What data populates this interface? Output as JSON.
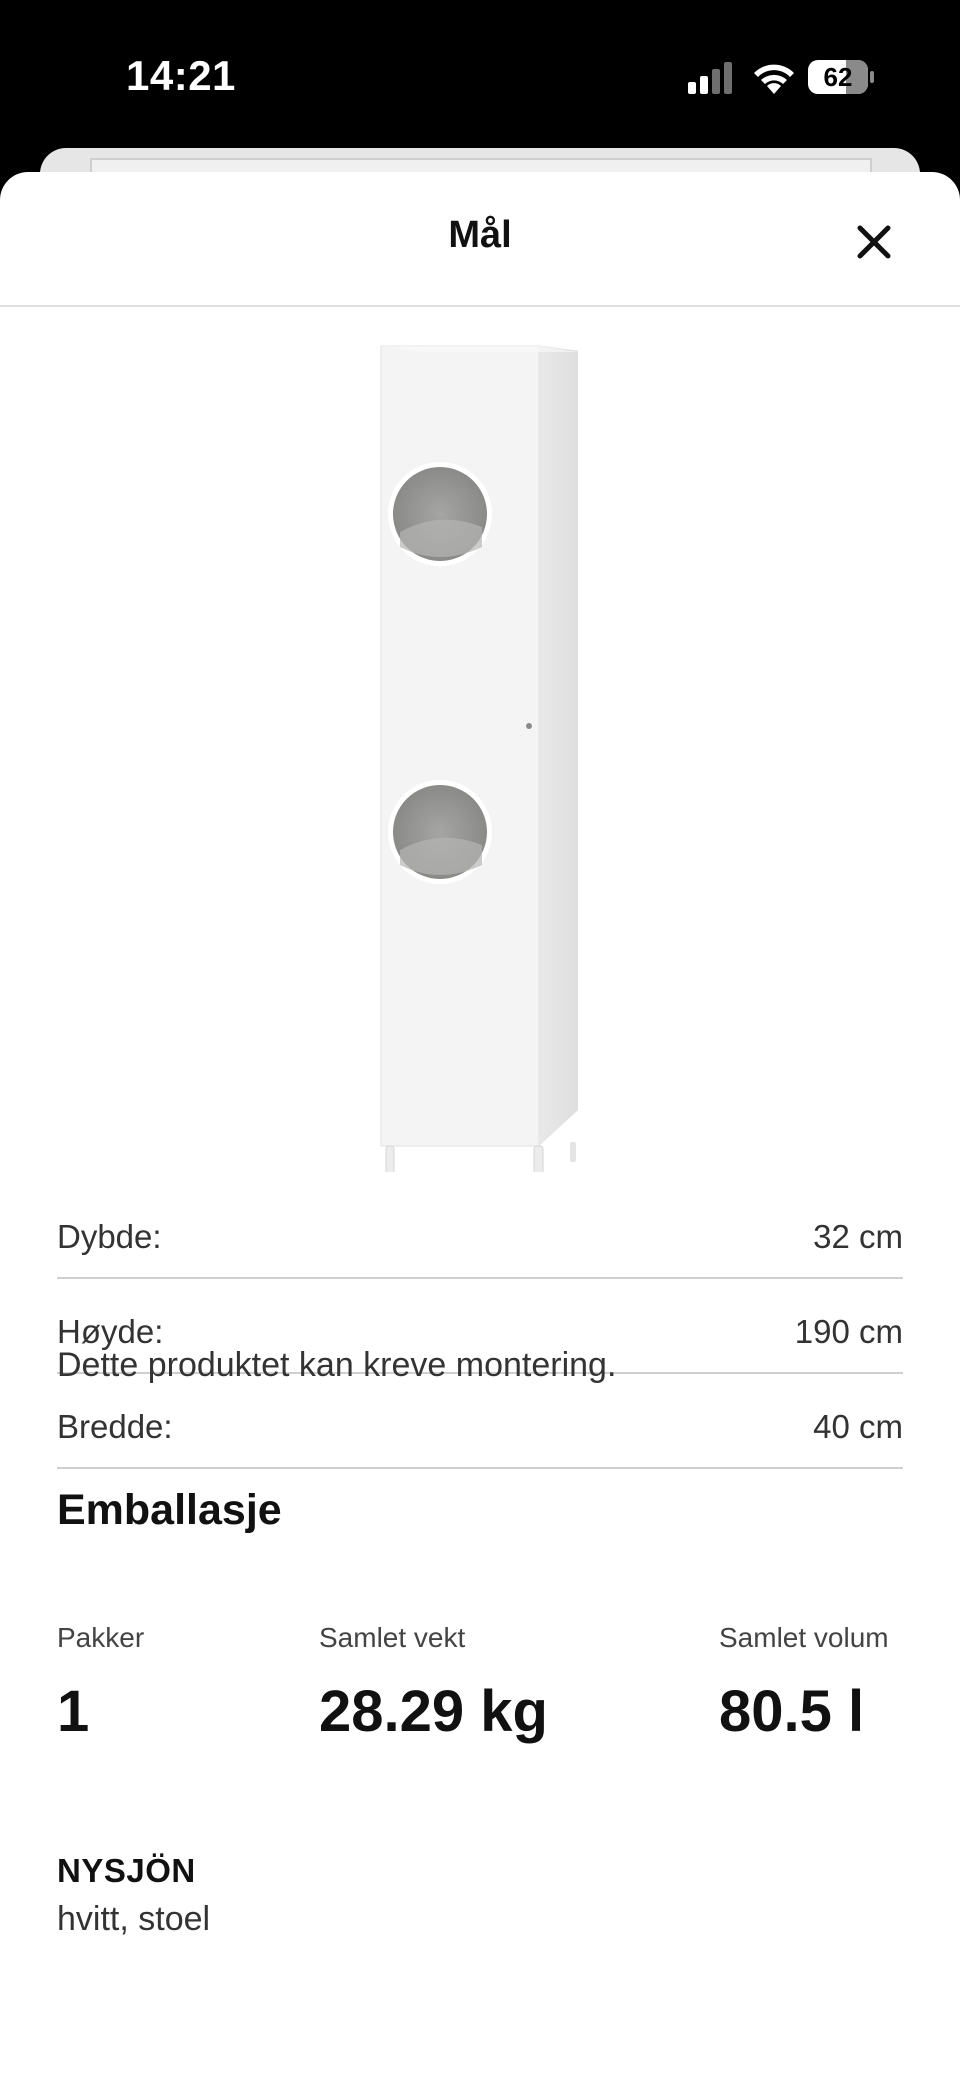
{
  "status_bar": {
    "time": "14:21",
    "battery": "62"
  },
  "modal": {
    "title": "Mål",
    "close_icon": "close-icon"
  },
  "dimensions": [
    {
      "label": "Dybde:",
      "value": "32 cm"
    },
    {
      "label": "Høyde:",
      "value": "190 cm"
    },
    {
      "label": "Bredde:",
      "value": "40 cm"
    }
  ],
  "assembly_note": "Dette produktet kan kreve montering.",
  "packaging": {
    "heading": "Emballasje",
    "stats": [
      {
        "label": "Pakker",
        "value": "1"
      },
      {
        "label": "Samlet vekt",
        "value": "28.29 kg"
      },
      {
        "label": "Samlet volum",
        "value": "80.5 l"
      }
    ]
  },
  "product": {
    "name": "NYSJÖN",
    "description": "hvitt, stoel"
  }
}
